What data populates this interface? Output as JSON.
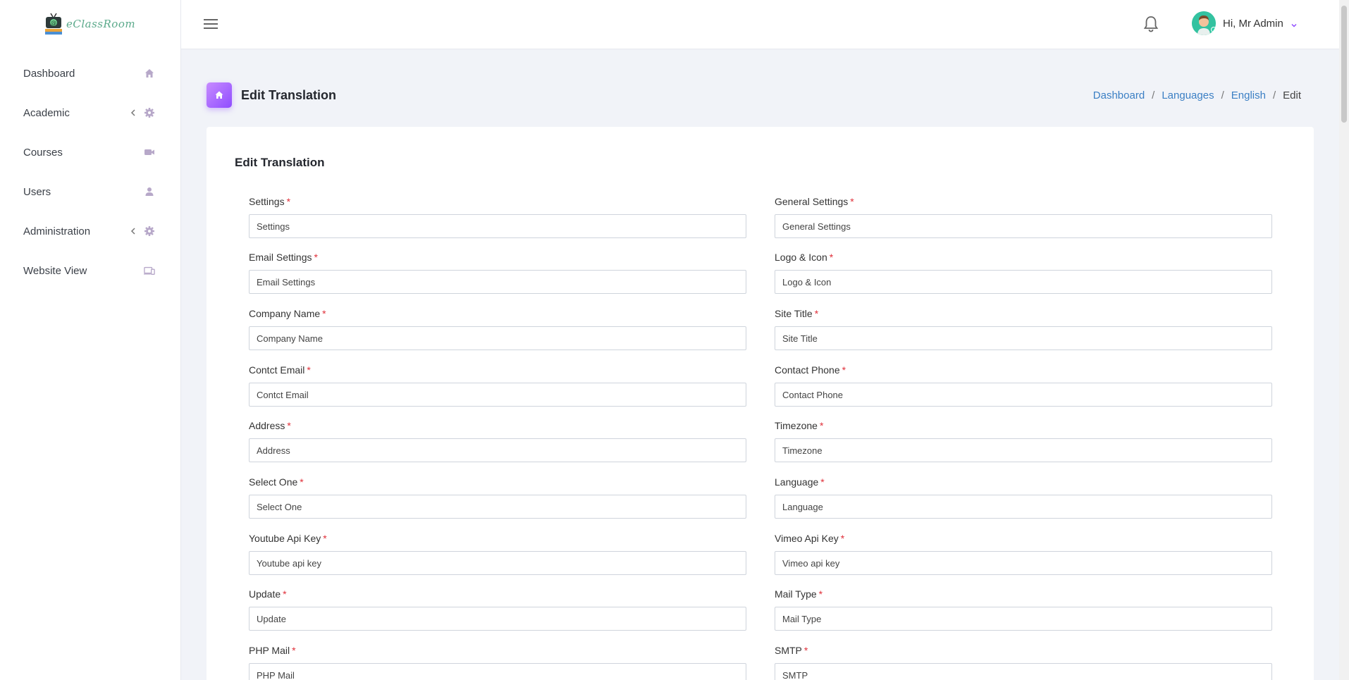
{
  "app": {
    "logo_text": "eClassRoom"
  },
  "sidebar": {
    "items": [
      {
        "label": "Dashboard",
        "icon": "home-icon",
        "chevron": false
      },
      {
        "label": "Academic",
        "icon": "gear-icon",
        "chevron": true
      },
      {
        "label": "Courses",
        "icon": "video-icon",
        "chevron": false
      },
      {
        "label": "Users",
        "icon": "user-icon",
        "chevron": false
      },
      {
        "label": "Administration",
        "icon": "gear-icon",
        "chevron": true
      },
      {
        "label": "Website View",
        "icon": "devices-icon",
        "chevron": false
      }
    ]
  },
  "topbar": {
    "user_greeting": "Hi, Mr Admin"
  },
  "page": {
    "title": "Edit Translation",
    "breadcrumb": {
      "dashboard": "Dashboard",
      "languages": "Languages",
      "english": "English",
      "current": "Edit"
    }
  },
  "card": {
    "title": "Edit Translation"
  },
  "form": {
    "required_mark": "*",
    "fields": [
      {
        "label": "Settings",
        "value": "Settings"
      },
      {
        "label": "General Settings",
        "value": "General Settings"
      },
      {
        "label": "Email Settings",
        "value": "Email Settings"
      },
      {
        "label": "Logo & Icon",
        "value": "Logo & Icon"
      },
      {
        "label": "Company Name",
        "value": "Company Name"
      },
      {
        "label": "Site Title",
        "value": "Site Title"
      },
      {
        "label": "Contct Email",
        "value": "Contct Email"
      },
      {
        "label": "Contact Phone",
        "value": "Contact Phone"
      },
      {
        "label": "Address",
        "value": "Address"
      },
      {
        "label": "Timezone",
        "value": "Timezone"
      },
      {
        "label": "Select One",
        "value": "Select One"
      },
      {
        "label": "Language",
        "value": "Language"
      },
      {
        "label": "Youtube Api Key",
        "value": "Youtube api key"
      },
      {
        "label": "Vimeo Api Key",
        "value": "Vimeo api key"
      },
      {
        "label": "Update",
        "value": "Update"
      },
      {
        "label": "Mail Type",
        "value": "Mail Type"
      },
      {
        "label": "PHP Mail",
        "value": "PHP Mail"
      },
      {
        "label": "SMTP",
        "value": "SMTP"
      }
    ]
  },
  "colors": {
    "accent": "#8f4dff",
    "link": "#3b7fc4",
    "required": "#e0303a",
    "sidebar_icon": "#b7a8c9"
  }
}
